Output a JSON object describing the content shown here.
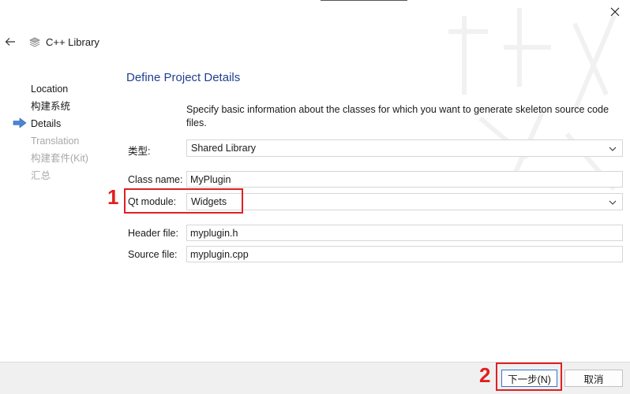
{
  "window": {
    "title": "C++ Library"
  },
  "steps": [
    {
      "label": "Location",
      "state": "done"
    },
    {
      "label": "构建系统",
      "state": "done"
    },
    {
      "label": "Details",
      "state": "current"
    },
    {
      "label": "Translation",
      "state": "disabled"
    },
    {
      "label": "构建套件(Kit)",
      "state": "disabled"
    },
    {
      "label": "汇总",
      "state": "disabled"
    }
  ],
  "page": {
    "heading": "Define Project Details",
    "description": "Specify basic information about the classes for which you want to generate skeleton source code files."
  },
  "form": {
    "type": {
      "label": "类型:",
      "value": "Shared Library"
    },
    "class_name": {
      "label": "Class name:",
      "value": "MyPlugin"
    },
    "qt_module": {
      "label": "Qt module:",
      "value": "Widgets"
    },
    "header_file": {
      "label": "Header file:",
      "value": "myplugin.h"
    },
    "source_file": {
      "label": "Source file:",
      "value": "myplugin.cpp"
    }
  },
  "annotations": {
    "one": "1",
    "two": "2"
  },
  "buttons": {
    "next": "下一步(N)",
    "cancel": "取消"
  },
  "colors": {
    "heading": "#1f3f8f",
    "annotation": "#e02020",
    "arrow": "#4a86d6",
    "footer": "#f0f0f0"
  },
  "icons": {
    "back": "arrow-left-icon",
    "close": "close-icon",
    "app": "library-stack-icon",
    "current_step": "arrow-right-icon",
    "dropdown": "chevron-down-icon"
  }
}
